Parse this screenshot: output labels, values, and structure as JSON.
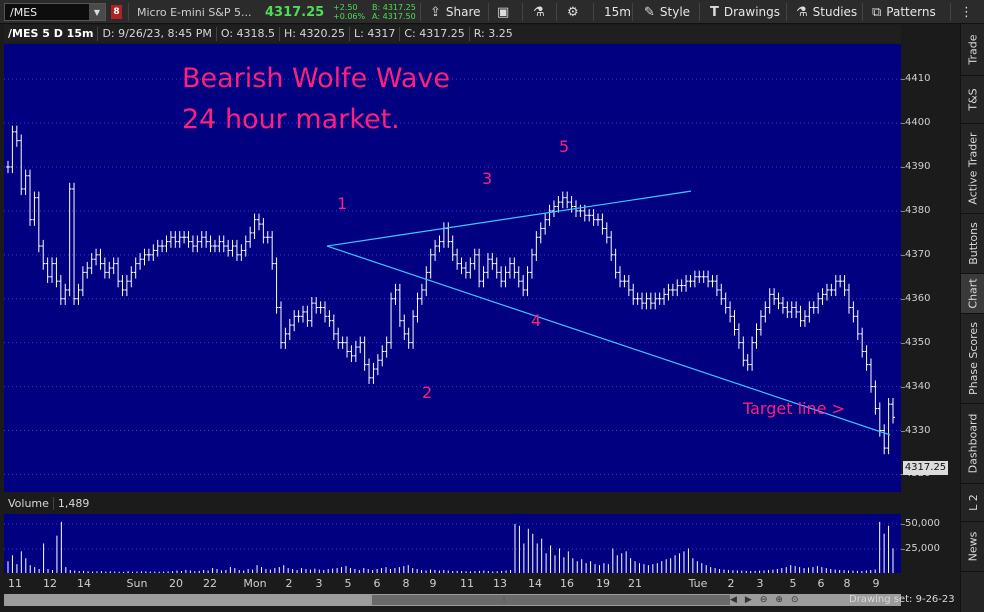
{
  "toolbar": {
    "symbol": "/MES",
    "link_label": "8",
    "description": "Micro E-mini S&P 5...",
    "last_price": "4317.25",
    "change_abs": "+2.50",
    "change_pct": "+0.06%",
    "bid": "B: 4317.25",
    "ask": "A: 4317.50",
    "share_label": "Share",
    "timeframe_label": "15m",
    "style_label": "Style",
    "drawings_label": "Drawings",
    "studies_label": "Studies",
    "patterns_label": "Patterns",
    "icons": [
      "share-icon",
      "snapshot-icon",
      "flask-icon",
      "gear-icon",
      "style-icon",
      "drawings-icon",
      "studies-icon",
      "patterns-icon",
      "dots-icon"
    ],
    "accent_color": "#4fdc57"
  },
  "info": {
    "chart_id": "/MES 5 D 15m",
    "date": "D: 9/26/23, 8:45 PM",
    "open": "O: 4318.5",
    "high": "H: 4320.25",
    "low": "L: 4317",
    "close": "C: 4317.25",
    "range": "R: 3.25"
  },
  "annotations": {
    "title_line1": "Bearish Wolfe Wave",
    "title_line2": "24 hour market.",
    "p1": "1",
    "p2": "2",
    "p3": "3",
    "p4": "4",
    "p5": "5",
    "target": "Target line >",
    "color": "#ff1f7e",
    "line_color": "#3cc8ff"
  },
  "price_axis": {
    "ticks": [
      "4410",
      "4400",
      "4390",
      "4380",
      "4370",
      "4360",
      "4350",
      "4340",
      "4330",
      "4320"
    ],
    "current_tag": "4317.25"
  },
  "volume": {
    "label": "Volume",
    "value": "1,489",
    "ticks": [
      "50,000",
      "25,000"
    ]
  },
  "time_axis": {
    "labels": [
      "11",
      "12",
      "14",
      "Sun",
      "20",
      "22",
      "Mon",
      "2",
      "3",
      "5",
      "6",
      "8",
      "9",
      "11",
      "13",
      "14",
      "16",
      "19",
      "21",
      "Tue",
      "2",
      "3",
      "5",
      "6",
      "8",
      "9"
    ]
  },
  "footer": {
    "drawing_set": "Drawing set: 9-26-23",
    "zoom_icons": [
      "zoom-out-icon",
      "zoom-in-icon",
      "zoom-fit-icon",
      "scroll-left-icon",
      "scroll-right-icon"
    ]
  },
  "sidebar": {
    "tabs": [
      "Trade",
      "T&S",
      "Active Trader",
      "Buttons",
      "Chart",
      "Phase Scores",
      "Dashboard",
      "L 2",
      "News"
    ],
    "active": "Chart"
  },
  "chart_data": {
    "type": "bar",
    "subtype": "ohlc",
    "instrument": "/MES",
    "interval": "15m",
    "ylim": [
      4316,
      4418
    ],
    "price_path": [
      4390,
      4398,
      4396,
      4385,
      4388,
      4378,
      4383,
      4372,
      4368,
      4365,
      4368,
      4364,
      4360,
      4362,
      4385,
      4360,
      4362,
      4366,
      4367,
      4369,
      4370,
      4368,
      4366,
      4367,
      4368,
      4364,
      4362,
      4364,
      4366,
      4368,
      4369,
      4370,
      4370,
      4371,
      4372,
      4372,
      4373,
      4374,
      4373,
      4374,
      4374,
      4373,
      4372,
      4373,
      4374,
      4373,
      4372,
      4372,
      4373,
      4372,
      4371,
      4372,
      4370,
      4371,
      4373,
      4375,
      4378,
      4377,
      4374,
      4374,
      4368,
      4358,
      4350,
      4352,
      4354,
      4356,
      4356,
      4357,
      4355,
      4359,
      4358,
      4358,
      4356,
      4355,
      4352,
      4350,
      4350,
      4348,
      4347,
      4349,
      4350,
      4345,
      4342,
      4344,
      4346,
      4348,
      4350,
      4360,
      4362,
      4355,
      4352,
      4350,
      4356,
      4360,
      4362,
      4366,
      4370,
      4372,
      4373,
      4376,
      4373,
      4370,
      4368,
      4367,
      4366,
      4368,
      4370,
      4364,
      4366,
      4369,
      4368,
      4366,
      4364,
      4366,
      4368,
      4366,
      4364,
      4362,
      4366,
      4370,
      4374,
      4376,
      4378,
      4380,
      4381,
      4382,
      4383,
      4382,
      4381,
      4380,
      4380,
      4379,
      4379,
      4378,
      4378,
      4376,
      4374,
      4370,
      4366,
      4364,
      4364,
      4362,
      4360,
      4360,
      4359,
      4360,
      4359,
      4360,
      4360,
      4361,
      4362,
      4362,
      4363,
      4363,
      4364,
      4364,
      4365,
      4365,
      4365,
      4364,
      4364,
      4362,
      4360,
      4358,
      4356,
      4353,
      4350,
      4346,
      4345,
      4350,
      4353,
      4356,
      4358,
      4361,
      4360,
      4359,
      4358,
      4357,
      4358,
      4357,
      4355,
      4356,
      4358,
      4358,
      4360,
      4361,
      4362,
      4362,
      4364,
      4364,
      4362,
      4358,
      4356,
      4352,
      4348,
      4345,
      4340,
      4335,
      4330,
      4326,
      4336,
      4333
    ],
    "wolfe_wave_points": [
      {
        "label": "1",
        "price": 4372
      },
      {
        "label": "2",
        "price": 4339
      },
      {
        "label": "3",
        "price": 4377
      },
      {
        "label": "4",
        "price": 4358
      },
      {
        "label": "5",
        "price": 4382
      }
    ],
    "trendlines": [
      {
        "name": "1-3 line",
        "from": 4372,
        "to": 4384.5
      },
      {
        "name": "1-4 target line",
        "from": 4372,
        "to": 4329
      }
    ],
    "volume_values": [
      12000,
      18000,
      9000,
      22000,
      15000,
      8000,
      6000,
      4000,
      30000,
      4000,
      3000,
      38000,
      52000,
      6000,
      3000,
      2500,
      2000,
      2200,
      1800,
      1500,
      1600,
      1900,
      1400,
      1700,
      1500,
      1300,
      1200,
      1800,
      1400,
      1500,
      1600,
      1700,
      1500,
      1400,
      1300,
      1500,
      1600,
      1800,
      2500,
      2000,
      3000,
      2500,
      1800,
      2200,
      3000,
      2500,
      5000,
      4000,
      2500,
      3000,
      6000,
      5000,
      3000,
      2500,
      4000,
      3500,
      8000,
      6000,
      4000,
      3500,
      5000,
      6000,
      8000,
      5000,
      4000,
      3000,
      5000,
      4000,
      3500,
      4500,
      3500,
      3000,
      4000,
      4500,
      5000,
      6000,
      7000,
      5000,
      4000,
      3000,
      5000,
      4000,
      3000,
      4000,
      5000,
      6000,
      4000,
      5000,
      6000,
      7000,
      8000,
      5000,
      4000,
      3000,
      2500,
      3500,
      3000,
      2500,
      3000,
      2500,
      2000,
      2200,
      2000,
      1800,
      1600,
      2000,
      2200,
      2500,
      2000,
      1500,
      1800,
      2200,
      2500,
      3000,
      50000,
      48000,
      30000,
      45000,
      40000,
      30000,
      35000,
      20000,
      28000,
      18000,
      25000,
      16000,
      22000,
      15000,
      12000,
      14000,
      10000,
      12000,
      9000,
      8000,
      10000,
      9000,
      25000,
      18000,
      20000,
      22000,
      15000,
      12000,
      10000,
      9000,
      8000,
      9000,
      10000,
      12000,
      14000,
      15000,
      18000,
      20000,
      22000,
      25000,
      15000,
      12000,
      10000,
      8000,
      6000,
      5000,
      4000,
      3500,
      3000,
      2800,
      2600,
      2400,
      2200,
      2000,
      2200,
      2400,
      2600,
      3000,
      3500,
      4000,
      5000,
      6000,
      8000,
      7000,
      6000,
      5000,
      5500,
      6000,
      7000,
      6000,
      5000,
      4000,
      3500,
      3000,
      2800,
      2600,
      2400,
      2200,
      2000,
      2500,
      3000,
      3500,
      52000,
      40000,
      48000,
      25000
    ]
  }
}
